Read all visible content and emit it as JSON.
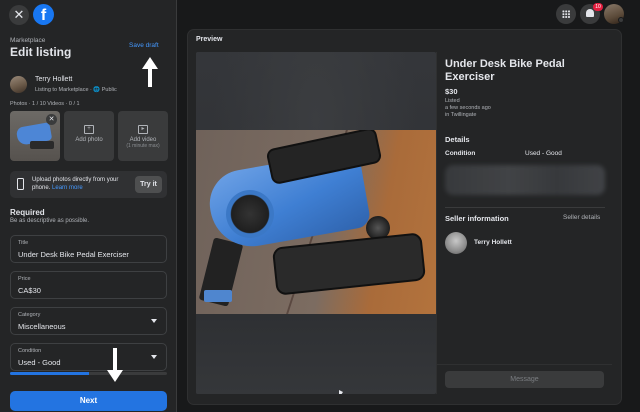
{
  "header": {
    "close_icon": "close-icon",
    "logo_icon": "facebook-logo-icon",
    "logo_letter": "f"
  },
  "sidebar": {
    "breadcrumb": "Marketplace",
    "title": "Edit listing",
    "save_draft_label": "Save draft",
    "user": {
      "name": "Terry Hollett",
      "subtitle": "Listing to Marketplace · 🌐 Public"
    },
    "media_count": "Photos · 1 / 10 Videos · 0 / 1",
    "add_photo_label": "Add photo",
    "add_video_label": "Add video",
    "add_video_sub": "(1 minute max)",
    "upload": {
      "text": "Upload photos directly from your phone.",
      "learn_more": "Learn more",
      "try_label": "Try it"
    },
    "required_title": "Required",
    "required_sub": "Be as descriptive as possible.",
    "fields": {
      "title": {
        "label": "Title",
        "value": "Under Desk Bike Pedal Exerciser"
      },
      "price": {
        "label": "Price",
        "value": "CA$30"
      },
      "category": {
        "label": "Category",
        "value": "Miscellaneous"
      },
      "condition": {
        "label": "Condition",
        "value": "Used - Good"
      }
    },
    "progress_fraction": 0.5,
    "next_label": "Next"
  },
  "topnav": {
    "menu_icon": "grid-menu-icon",
    "notifications_icon": "bell-icon",
    "notification_count": "10"
  },
  "preview": {
    "heading": "Preview",
    "listing_title": "Under Desk Bike Pedal Exerciser",
    "price": "$30",
    "listed_status": "Listed",
    "listed_time": "a few seconds ago",
    "listed_location": "in Twillingate",
    "details_heading": "Details",
    "condition_label": "Condition",
    "condition_value": "Used - Good",
    "seller_heading": "Seller information",
    "seller_details_link": "Seller details",
    "seller_name": "Terry Hollett",
    "message_label": "Message"
  },
  "colors": {
    "accent": "#2374e1",
    "link": "#4599ff",
    "badge": "#e41e3f",
    "surface": "#242526",
    "background": "#18191a"
  }
}
